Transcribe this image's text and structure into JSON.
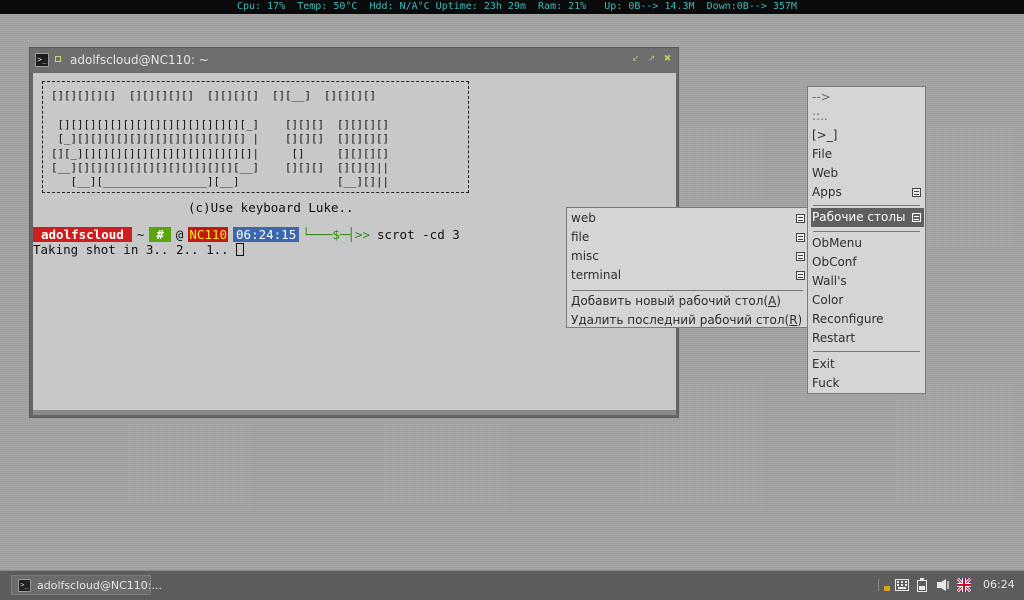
{
  "topbar": {
    "status": "Cpu: 17%  Temp: 50°C  Hdd: N/A°C Uptime: 23h 29m  Ram: 21%   Up: 0B--> 14.3M  Down:0B--> 357M"
  },
  "terminal": {
    "title": "adolfscloud@NC110: ~",
    "logo": [
      "[][][][][]  [][][][][]  [][][][]  [][__]  [][][][]",
      "",
      " [][][][][][][][][][][][][][][_]    [][][]  [][][][]",
      " [_][][][][][][][][][][][][][] |    [][][]  [][][][]",
      "[][_][][][][][][][][][][][][][]|     []     [][][][]",
      "[__][][][][][][][][][][][][][__]    [][][]  [][][]||",
      "   [__][________________][__]               [__][]||"
    ],
    "credit": "(c)Use keyboard Luke..",
    "prompt": {
      "user": "adolfscloud",
      "tilde": "~",
      "hash": "#",
      "at": "@",
      "host": "NC110",
      "time": "06:24:15",
      "arrow": "└───$─┤>>",
      "command": "scrot -cd 3"
    },
    "output": "Taking shot in 3.. 2.. 1.. "
  },
  "root_menu": {
    "items": [
      {
        "label": "-->"
      },
      {
        "label": "::.."
      },
      {
        "label": "[>_]"
      },
      {
        "label": "File"
      },
      {
        "label": "Web"
      },
      {
        "label": "Apps"
      },
      {
        "label": "Рабочие столы"
      },
      {
        "label": "ObMenu"
      },
      {
        "label": "ObConf"
      },
      {
        "label": "Wall's"
      },
      {
        "label": "Color"
      },
      {
        "label": "Reconfigure"
      },
      {
        "label": "Restart"
      },
      {
        "label": "Exit"
      },
      {
        "label": "Fuck"
      }
    ]
  },
  "desktops_menu": {
    "items": [
      {
        "label": "web"
      },
      {
        "label": "file"
      },
      {
        "label": "misc"
      },
      {
        "label": "terminal"
      }
    ],
    "add_label": "Добавить новый рабочий стол(",
    "add_key": "A",
    "remove_label": "Удалить последний рабочий стол(",
    "remove_key": "R",
    "close_paren": ")"
  },
  "panel": {
    "task_label": "adolfscloud@NC110:...",
    "clock": "06:24"
  },
  "colors": {
    "accent_green": "#5aa50c",
    "prompt_red": "#d01e1e",
    "time_blue": "#3b67b0",
    "topbar_text": "#3fb9b9"
  }
}
